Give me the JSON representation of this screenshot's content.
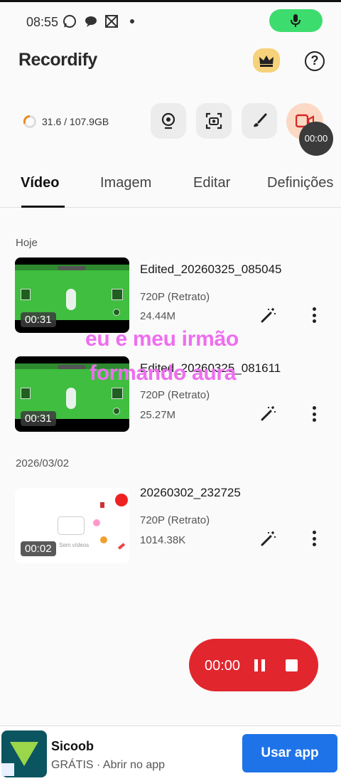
{
  "status_bar": {
    "time": "08:55",
    "icons": [
      "whatsapp-icon",
      "chat-icon",
      "gallery-icon",
      "dot-icon"
    ],
    "mic_color": "#3ddc6e"
  },
  "header": {
    "app_name": "Recordify",
    "premium_icon": "crown-icon",
    "help_label": "?"
  },
  "storage": {
    "text": "31.6 / 107.9GB",
    "used_fraction": 0.29
  },
  "tools": [
    "webcam-icon",
    "screenshot-icon",
    "brush-icon",
    "record-video-icon"
  ],
  "floating_timer": "00:00",
  "tabs": [
    {
      "label": "Vídeo",
      "active": true
    },
    {
      "label": "Imagem",
      "active": false
    },
    {
      "label": "Editar",
      "active": false
    },
    {
      "label": "Definições",
      "active": false
    }
  ],
  "sections": [
    {
      "label": "Hoje",
      "videos": [
        {
          "title": "Edited_20260325_085045",
          "resolution": "720P (Retrato)",
          "size": "24.44M",
          "duration": "00:31"
        },
        {
          "title": "Edited_20260325_081611",
          "resolution": "720P (Retrato)",
          "size": "25.27M",
          "duration": "00:31"
        }
      ]
    },
    {
      "label": "2026/03/02",
      "videos": [
        {
          "title": "20260302_232725",
          "resolution": "720P (Retrato)",
          "size": "1014.38K",
          "duration": "00:02",
          "thumb_caption": "Sem vídeos"
        }
      ]
    }
  ],
  "overlay_caption": {
    "line1": "eu e meu irmão",
    "line2": "formando aura",
    "color": "#ee6ef0"
  },
  "recording_control": {
    "time": "00:00",
    "color": "#e2262e"
  },
  "ad": {
    "title": "Sicoob",
    "subtitle": "GRÁTIS · Abrir no app",
    "cta": "Usar app"
  }
}
